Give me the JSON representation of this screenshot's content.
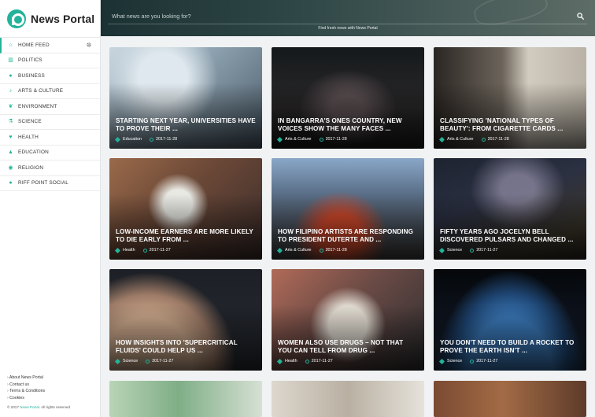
{
  "brand": {
    "name": "News Portal",
    "accent": "#23b39a"
  },
  "search": {
    "placeholder": "What news are you looking for?",
    "tagline": "Find fresh news with News Portal"
  },
  "nav": [
    {
      "label": "HOME FEED",
      "icon": "home-icon",
      "active": true
    },
    {
      "label": "POLITICS",
      "icon": "institution-icon"
    },
    {
      "label": "BUSINESS",
      "icon": "globe-icon"
    },
    {
      "label": "ARTS & CULTURE",
      "icon": "music-icon"
    },
    {
      "label": "ENVIRONMENT",
      "icon": "leaf-icon"
    },
    {
      "label": "SCIENCE",
      "icon": "flask-icon"
    },
    {
      "label": "HEALTH",
      "icon": "heart-icon"
    },
    {
      "label": "EDUCATION",
      "icon": "graduation-cap-icon"
    },
    {
      "label": "RELIGION",
      "icon": "eye-icon"
    },
    {
      "label": "RIFF POINT SOCIAL",
      "icon": "users-icon"
    }
  ],
  "footer": {
    "links": [
      "About News Portal",
      "Contact us",
      "Terms & Conditions",
      "Cookies"
    ],
    "copyright_prefix": "© 2017",
    "copyright_brand": "News Portal",
    "copyright_suffix": ". All rights reserved"
  },
  "articles": [
    {
      "title": "STARTING NEXT YEAR, UNIVERSITIES HAVE TO PROVE THEIR ...",
      "category": "Education",
      "date": "2017-11-28",
      "image": "img-lab"
    },
    {
      "title": "IN BANGARRA'S ONES COUNTRY, NEW VOICES SHOW THE MANY FACES ...",
      "category": "Arts & Culture",
      "date": "2017-11-28",
      "image": "img-dance"
    },
    {
      "title": "CLASSIFYING 'NATIONAL TYPES OF BEAUTY': FROM CIGARETTE CARDS ...",
      "category": "Arts & Culture",
      "date": "2017-11-28",
      "image": "img-beauty"
    },
    {
      "title": "LOW-INCOME EARNERS ARE MORE LIKELY TO DIE EARLY FROM ...",
      "category": "Health",
      "date": "2017-11-27",
      "image": "img-card"
    },
    {
      "title": "HOW FILIPINO ARTISTS ARE RESPONDING TO PRESIDENT DUTERTE AND ...",
      "category": "Arts & Culture",
      "date": "2017-11-28",
      "image": "img-protest"
    },
    {
      "title": "FIFTY YEARS AGO JOCELYN BELL DISCOVERED PULSARS AND CHANGED ...",
      "category": "Science",
      "date": "2017-11-27",
      "image": "img-stars"
    },
    {
      "title": "HOW INSIGHTS INTO 'SUPERCRITICAL FLUIDS' COULD HELP US ...",
      "category": "Science",
      "date": "2017-11-27",
      "image": "img-jupiter"
    },
    {
      "title": "WOMEN ALSO USE DRUGS – NOT THAT YOU CAN TELL FROM DRUG ...",
      "category": "Health",
      "date": "2017-11-27",
      "image": "img-drugs"
    },
    {
      "title": "YOU DON'T NEED TO BUILD A ROCKET TO PROVE THE EARTH ISN'T ...",
      "category": "Science",
      "date": "2017-11-27",
      "image": "img-earth"
    }
  ],
  "partial_row": [
    "img-row4a",
    "img-row4b",
    "img-row4c"
  ]
}
